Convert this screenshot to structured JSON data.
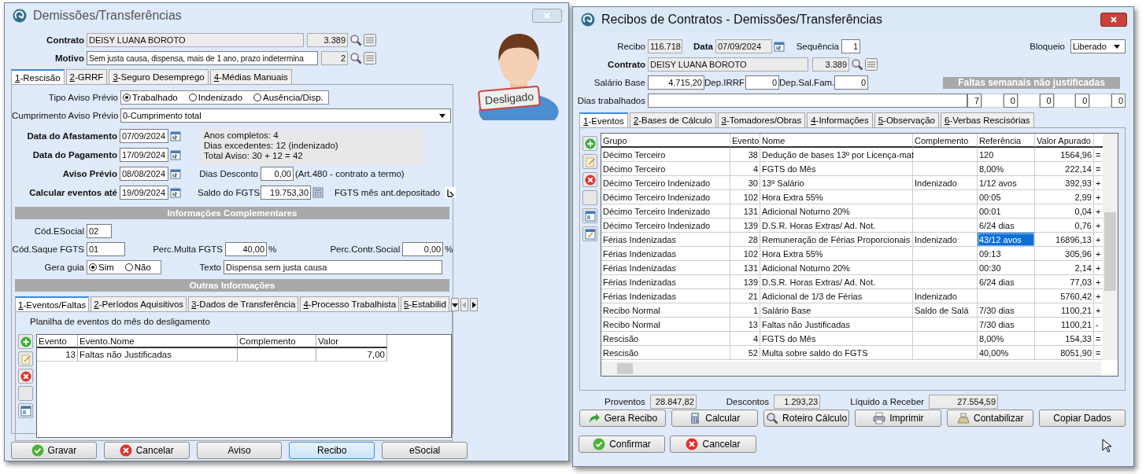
{
  "dismissal_window": {
    "title": "Demissões/Transferências",
    "contrato": {
      "label": "Contrato",
      "name": "DEISY LUANA BOROTO",
      "number": "3.389"
    },
    "motivo": {
      "label": "Motivo",
      "text": "Sem justa causa, dispensa, mais de 1 ano, prazo indetermina",
      "number": "2"
    },
    "status_badge": "Desligado",
    "tabs": [
      {
        "label": "1-Rescisão",
        "selected": true
      },
      {
        "label": "2-GRRF",
        "selected": false
      },
      {
        "label": "3-Seguro Desemprego",
        "selected": false
      },
      {
        "label": "4-Médias Manuais",
        "selected": false
      }
    ],
    "tipo_aviso": {
      "label": "Tipo Aviso Prévio",
      "options": [
        {
          "label": "Trabalhado",
          "selected": true
        },
        {
          "label": "Indenizado",
          "selected": false
        },
        {
          "label": "Ausência/Disp.",
          "selected": false
        }
      ]
    },
    "cumprimento": {
      "label": "Cumprimento Aviso Prévio",
      "value": "0-Cumprimento total"
    },
    "dates": [
      {
        "label": "Data do Afastamento",
        "value": "07/09/2024"
      },
      {
        "label": "Data do Pagamento",
        "value": "17/09/2024"
      },
      {
        "label": "Aviso Prévio",
        "value": "08/08/2024"
      },
      {
        "label": "Calcular eventos até",
        "value": "19/09/2024"
      }
    ],
    "summary_lines": [
      "Anos completos: 4",
      "Dias excedentes: 12 (indenizado)",
      "Total Aviso: 30 + 12 = 42"
    ],
    "dias_desconto": {
      "label": "Dias Desconto",
      "value": "0,00",
      "note": "(Art.480 - contrato a termo)"
    },
    "saldo_fgts": {
      "label": "Saldo do FGTS",
      "value": "19.753,30"
    },
    "fgts_mes_ant": {
      "label": "FGTS mês ant.depositado"
    },
    "complementary_heading": "Informações Complementares",
    "cod_esocial": {
      "label": "Cód.ESocial",
      "value": "02"
    },
    "cod_saque": {
      "label": "Cód.Saque FGTS",
      "value": "01"
    },
    "perc_multa": {
      "label": "Perc.Multa FGTS",
      "value": "40,00",
      "unit": "%"
    },
    "perc_contr": {
      "label": "Perc.Contr.Social",
      "value": "0,00",
      "unit": "%"
    },
    "gera_guia": {
      "label": "Gera guia",
      "options": [
        {
          "label": "Sim",
          "selected": true
        },
        {
          "label": "Não",
          "selected": false
        }
      ]
    },
    "texto": {
      "label": "Texto",
      "value": "Dispensa sem justa causa"
    },
    "other_heading": "Outras Informações",
    "inner_tabs": [
      {
        "label": "1-Eventos/Faltas",
        "selected": true
      },
      {
        "label": "2-Períodos Aquisitivos",
        "selected": false
      },
      {
        "label": "3-Dados de Transferência",
        "selected": false
      },
      {
        "label": "4-Processo Trabalhista",
        "selected": false
      },
      {
        "label": "5-Estabilid",
        "selected": false
      }
    ],
    "planilha_caption": "Planilha de eventos do mês do desligamento",
    "events_table": {
      "columns": [
        "Evento",
        "Evento.Nome",
        "Complemento",
        "Valor"
      ],
      "rows": [
        {
          "evento": "13",
          "nome": "Faltas não Justificadas",
          "valor": "7,00"
        }
      ]
    },
    "buttons": [
      {
        "label": "Gravar",
        "kind": "confirm",
        "focused": false
      },
      {
        "label": "Cancelar",
        "kind": "cancel",
        "focused": false
      },
      {
        "label": "Aviso",
        "focused": false
      },
      {
        "label": "Recibo",
        "focused": true
      },
      {
        "label": "eSocial",
        "focused": false
      }
    ]
  },
  "receipt_window": {
    "title": "Recibos de Contratos - Demissões/Transferências",
    "recibo": {
      "label": "Recibo",
      "value": "116.718"
    },
    "data": {
      "label": "Data",
      "value": "07/09/2024"
    },
    "sequencia": {
      "label": "Sequência",
      "value": "1"
    },
    "bloqueio": {
      "label": "Bloqueio",
      "value": "Liberado"
    },
    "contrato": {
      "label": "Contrato",
      "name": "DEISY LUANA BOROTO",
      "number": "3.389"
    },
    "salario_base": {
      "label": "Salário Base",
      "value": "4.715,20"
    },
    "dep_irrf": {
      "label": "Dep.IRRF",
      "value": "0"
    },
    "dep_sal_fam": {
      "label": "Dep.Sal.Fam.",
      "value": "0"
    },
    "faltas_heading": "Faltas semanais não justificadas",
    "dias_trabalhados": {
      "label": "Dias trabalhados",
      "weekly_values": [
        "7",
        "0",
        "0",
        "0",
        "0"
      ]
    },
    "tabs": [
      {
        "label": "1-Eventos",
        "selected": true
      },
      {
        "label": "2-Bases de Cálculo",
        "selected": false
      },
      {
        "label": "3-Tomadores/Obras",
        "selected": false
      },
      {
        "label": "4-Informações",
        "selected": false
      },
      {
        "label": "5-Observação",
        "selected": false
      },
      {
        "label": "6-Verbas Rescisórias",
        "selected": false
      }
    ],
    "grid": {
      "columns": [
        "Grupo",
        "Evento",
        "Nome",
        "Complemento",
        "Referência",
        "Valor Apurado"
      ],
      "rows": [
        {
          "grupo": "Décimo Terceiro",
          "evento": "38",
          "nome": "Dedução de bases 13º por Licença-mat",
          "referencia": "120",
          "valor": "1564,96",
          "sinal": "=",
          "selected": false
        },
        {
          "grupo": "Décimo Terceiro",
          "evento": "4",
          "nome": "FGTS do Mês",
          "referencia": "8,00%",
          "valor": "222,14",
          "sinal": "=",
          "selected": false
        },
        {
          "grupo": "Décimo Terceiro Indenizado",
          "evento": "30",
          "nome": "13º Salário",
          "complemento": "Indenizado",
          "referencia": "1/12 avos",
          "valor": "392,93",
          "sinal": "+",
          "selected": false
        },
        {
          "grupo": "Décimo Terceiro Indenizado",
          "evento": "102",
          "nome": "Hora Extra 55%",
          "referencia": "00:05",
          "valor": "2,99",
          "sinal": "+",
          "selected": false
        },
        {
          "grupo": "Décimo Terceiro Indenizado",
          "evento": "131",
          "nome": "Adicional Noturno 20%",
          "referencia": "00:01",
          "valor": "0,04",
          "sinal": "+",
          "selected": false
        },
        {
          "grupo": "Décimo Terceiro Indenizado",
          "evento": "139",
          "nome": "D.S.R. Horas Extras/ Ad. Not.",
          "referencia": "6/24 dias",
          "valor": "0,76",
          "sinal": "+",
          "selected": false
        },
        {
          "grupo": "Férias Indenizadas",
          "evento": "28",
          "nome": "Remuneração de Férias Proporcionais",
          "complemento": "Indenizado",
          "referencia": "43/12 avos",
          "valor": "16896,13",
          "sinal": "+",
          "selected": true
        },
        {
          "grupo": "Férias Indenizadas",
          "evento": "102",
          "nome": "Hora Extra 55%",
          "referencia": "09:13",
          "valor": "305,96",
          "sinal": "+",
          "selected": false
        },
        {
          "grupo": "Férias Indenizadas",
          "evento": "131",
          "nome": "Adicional Noturno 20%",
          "referencia": "00:30",
          "valor": "2,14",
          "sinal": "+",
          "selected": false
        },
        {
          "grupo": "Férias Indenizadas",
          "evento": "139",
          "nome": "D.S.R. Horas Extras/ Ad. Not.",
          "referencia": "6/24 dias",
          "valor": "77,03",
          "sinal": "+",
          "selected": false
        },
        {
          "grupo": "Férias Indenizadas",
          "evento": "21",
          "nome": "Adicional de 1/3 de Férias",
          "complemento": "Indenizado",
          "valor": "5760,42",
          "sinal": "+",
          "selected": false
        },
        {
          "grupo": "Recibo Normal",
          "evento": "1",
          "nome": "Salário Base",
          "complemento": "Saldo de Salá",
          "referencia": "7/30 dias",
          "valor": "1100,21",
          "sinal": "+",
          "selected": false
        },
        {
          "grupo": "Recibo Normal",
          "evento": "13",
          "nome": "Faltas não Justificadas",
          "referencia": "7/30 dias",
          "valor": "1100,21",
          "sinal": "-",
          "selected": false
        },
        {
          "grupo": "Rescisão",
          "evento": "4",
          "nome": "FGTS do Mês",
          "referencia": "8,00%",
          "valor": "154,33",
          "sinal": "=",
          "selected": false
        },
        {
          "grupo": "Rescisão",
          "evento": "52",
          "nome": "Multa sobre saldo do FGTS",
          "referencia": "40,00%",
          "valor": "8051,90",
          "sinal": "=",
          "selected": false
        }
      ]
    },
    "totals": [
      {
        "label": "Proventos",
        "value": "28.847,82"
      },
      {
        "label": "Descontos",
        "value": "1.293,23"
      },
      {
        "label": "Líquido a Receber",
        "value": "27.554,59"
      }
    ],
    "action_buttons": [
      {
        "label": "Gera Recibo",
        "kind": "generate"
      },
      {
        "label": "Calcular",
        "kind": "calculate"
      },
      {
        "label": "Roteiro Cálculo",
        "kind": "inspect"
      },
      {
        "label": "Imprimir",
        "kind": "print"
      },
      {
        "label": "Contabilizar",
        "kind": "post"
      },
      {
        "label": "Copiar Dados"
      }
    ],
    "confirm_buttons": [
      {
        "label": "Confirmar",
        "kind": "confirm"
      },
      {
        "label": "Cancelar",
        "kind": "cancel"
      }
    ]
  }
}
